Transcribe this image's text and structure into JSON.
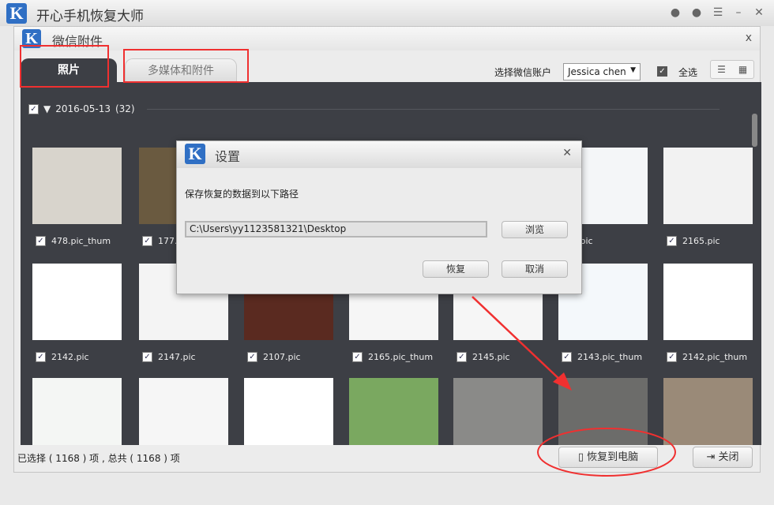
{
  "app": {
    "title": "开心手机恢复大师",
    "logo_letter": "K",
    "icons": [
      "wechat-icon",
      "chat-icon",
      "feedback-icon",
      "minimize-icon",
      "close-icon"
    ]
  },
  "panel": {
    "title": "微信附件",
    "close": "x"
  },
  "tabs": [
    {
      "label": "照片",
      "active": true
    },
    {
      "label": "多媒体和附件",
      "active": false
    }
  ],
  "toolbar": {
    "account_label": "选择微信账户",
    "account_value": "Jessica chen",
    "select_all": "全选",
    "select_all_checked": true
  },
  "group": {
    "date": "2016-05-13",
    "count": "(32)"
  },
  "files": [
    [
      "478.pic_thum",
      "177.video",
      "",
      "",
      "",
      ".pic",
      "2165.pic"
    ],
    [
      "2142.pic",
      "2147.pic",
      "2107.pic",
      "2165.pic_thum",
      "2145.pic",
      "2143.pic_thum",
      "2142.pic_thum"
    ],
    [
      "",
      "",
      "",
      "",
      "",
      "",
      ""
    ]
  ],
  "thumb_colors": [
    [
      "#d8d4cc",
      "#6a5a40",
      "#8a7a6a",
      "#2a3a2a",
      "#202020",
      "#f4f6f8",
      "#f2f2f2"
    ],
    [
      "#ffffff",
      "#f4f4f4",
      "#5a2a20",
      "#f6f6f6",
      "#f6f6f6",
      "#f4f8fb",
      "#ffffff"
    ],
    [
      "#f4f6f4",
      "#f6f6f6",
      "#ffffff",
      "#7aa860",
      "#8a8a88",
      "#6c6c6a",
      "#9a8a78"
    ]
  ],
  "status": "已选择 ( 1168 ) 项 , 总共 ( 1168 ) 项",
  "buttons": {
    "restore_pc": "恢复到电脑",
    "close": "关闭"
  },
  "dialog": {
    "title": "设置",
    "message": "保存恢复的数据到以下路径",
    "path": "C:\\Users\\yy1123581321\\Desktop",
    "browse": "浏览",
    "restore": "恢复",
    "cancel": "取消"
  },
  "annotation_color": "#f03030"
}
